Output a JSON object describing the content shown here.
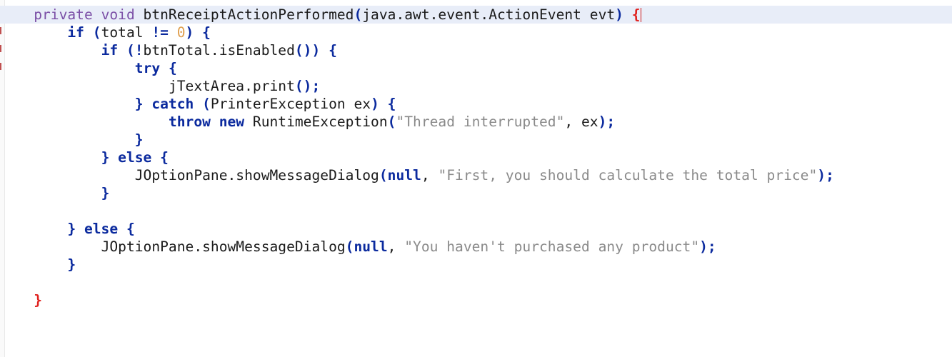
{
  "editor": {
    "colors": {
      "background": "#ffffff",
      "current_line": "#e8edf8",
      "keyword": "#0b2a9e",
      "declaration_keyword": "#7b4fa6",
      "string": "#8a8a8a",
      "number": "#e0a050",
      "matched_brace": "#e0221f",
      "gutter_mark": "#e0221f"
    },
    "lines": [
      {
        "indent": "    ",
        "current": true,
        "tokens": [
          {
            "c": "kw-decl",
            "t": "private"
          },
          {
            "c": "plain",
            "t": " "
          },
          {
            "c": "kw-decl",
            "t": "void"
          },
          {
            "c": "plain",
            "t": " btnReceiptActionPerformed"
          },
          {
            "c": "punct",
            "t": "("
          },
          {
            "c": "plain",
            "t": "java.awt.event.ActionEvent evt"
          },
          {
            "c": "punct",
            "t": ")"
          },
          {
            "c": "plain",
            "t": " "
          },
          {
            "c": "brace-red",
            "t": "{"
          }
        ]
      },
      {
        "indent": "        ",
        "tokens": [
          {
            "c": "kw",
            "t": "if"
          },
          {
            "c": "plain",
            "t": " "
          },
          {
            "c": "punct",
            "t": "("
          },
          {
            "c": "plain",
            "t": "total "
          },
          {
            "c": "punct",
            "t": "!="
          },
          {
            "c": "plain",
            "t": " "
          },
          {
            "c": "num",
            "t": "0"
          },
          {
            "c": "punct",
            "t": ")"
          },
          {
            "c": "plain",
            "t": " "
          },
          {
            "c": "punct",
            "t": "{"
          }
        ]
      },
      {
        "indent": "            ",
        "tokens": [
          {
            "c": "kw",
            "t": "if"
          },
          {
            "c": "plain",
            "t": " "
          },
          {
            "c": "punct",
            "t": "(!"
          },
          {
            "c": "plain",
            "t": "btnTotal.isEnabled"
          },
          {
            "c": "punct",
            "t": "())"
          },
          {
            "c": "plain",
            "t": " "
          },
          {
            "c": "punct",
            "t": "{"
          }
        ]
      },
      {
        "indent": "                ",
        "tokens": [
          {
            "c": "kw",
            "t": "try"
          },
          {
            "c": "plain",
            "t": " "
          },
          {
            "c": "punct",
            "t": "{"
          }
        ]
      },
      {
        "indent": "                    ",
        "tokens": [
          {
            "c": "plain",
            "t": "jTextArea.print"
          },
          {
            "c": "punct",
            "t": "();"
          }
        ]
      },
      {
        "indent": "                ",
        "tokens": [
          {
            "c": "punct",
            "t": "}"
          },
          {
            "c": "plain",
            "t": " "
          },
          {
            "c": "kw",
            "t": "catch"
          },
          {
            "c": "plain",
            "t": " "
          },
          {
            "c": "punct",
            "t": "("
          },
          {
            "c": "plain",
            "t": "PrinterException ex"
          },
          {
            "c": "punct",
            "t": ")"
          },
          {
            "c": "plain",
            "t": " "
          },
          {
            "c": "punct",
            "t": "{"
          }
        ]
      },
      {
        "indent": "                    ",
        "tokens": [
          {
            "c": "kw",
            "t": "throw"
          },
          {
            "c": "plain",
            "t": " "
          },
          {
            "c": "kw",
            "t": "new"
          },
          {
            "c": "plain",
            "t": " RuntimeException"
          },
          {
            "c": "punct",
            "t": "("
          },
          {
            "c": "str",
            "t": "\"Thread interrupted\""
          },
          {
            "c": "plain",
            "t": ", ex"
          },
          {
            "c": "punct",
            "t": ");"
          }
        ]
      },
      {
        "indent": "                ",
        "tokens": [
          {
            "c": "punct",
            "t": "}"
          }
        ]
      },
      {
        "indent": "            ",
        "tokens": [
          {
            "c": "punct",
            "t": "}"
          },
          {
            "c": "plain",
            "t": " "
          },
          {
            "c": "kw",
            "t": "else"
          },
          {
            "c": "plain",
            "t": " "
          },
          {
            "c": "punct",
            "t": "{"
          }
        ]
      },
      {
        "indent": "                ",
        "tokens": [
          {
            "c": "plain",
            "t": "JOptionPane.showMessageDialog"
          },
          {
            "c": "punct",
            "t": "("
          },
          {
            "c": "kw",
            "t": "null"
          },
          {
            "c": "plain",
            "t": ", "
          },
          {
            "c": "str",
            "t": "\"First, you should calculate the total price\""
          },
          {
            "c": "punct",
            "t": ");"
          }
        ]
      },
      {
        "indent": "            ",
        "tokens": [
          {
            "c": "punct",
            "t": "}"
          }
        ]
      },
      {
        "indent": "",
        "tokens": []
      },
      {
        "indent": "        ",
        "tokens": [
          {
            "c": "punct",
            "t": "}"
          },
          {
            "c": "plain",
            "t": " "
          },
          {
            "c": "kw",
            "t": "else"
          },
          {
            "c": "plain",
            "t": " "
          },
          {
            "c": "punct",
            "t": "{"
          }
        ]
      },
      {
        "indent": "            ",
        "tokens": [
          {
            "c": "plain",
            "t": "JOptionPane.showMessageDialog"
          },
          {
            "c": "punct",
            "t": "("
          },
          {
            "c": "kw",
            "t": "null"
          },
          {
            "c": "plain",
            "t": ", "
          },
          {
            "c": "str",
            "t": "\"You haven't purchased any product\""
          },
          {
            "c": "punct",
            "t": ");"
          }
        ]
      },
      {
        "indent": "        ",
        "tokens": [
          {
            "c": "punct",
            "t": "}"
          }
        ]
      },
      {
        "indent": "",
        "tokens": []
      },
      {
        "indent": "    ",
        "tokens": [
          {
            "c": "brace-red",
            "t": "}"
          }
        ]
      }
    ]
  }
}
